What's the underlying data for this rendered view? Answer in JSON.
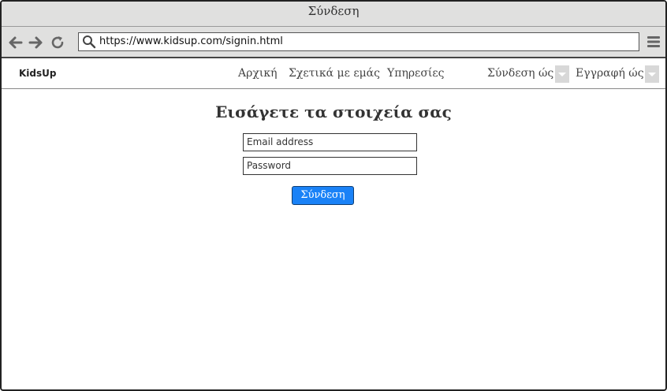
{
  "window": {
    "title": "Σύνδεση"
  },
  "toolbar": {
    "url": "https://www.kidsup.com/signin.html",
    "back_icon": "arrow-left-icon",
    "forward_icon": "arrow-right-icon",
    "reload_icon": "reload-icon",
    "search_icon": "search-icon",
    "menu_icon": "hamburger-menu-icon"
  },
  "navbar": {
    "brand": "KidsUp",
    "links": [
      "Αρχική",
      "Σχετικά με εμάς",
      "Υπηρεσίες"
    ],
    "login_as": "Σύνδεση ώς",
    "register_as": "Εγγραφή ώς"
  },
  "form": {
    "heading": "Εισάγετε τα στοιχεία σας",
    "email_placeholder": "Email address",
    "password_placeholder": "Password",
    "submit_label": "Σύνδεση"
  },
  "colors": {
    "button": "#1a82f7",
    "chrome": "#e0e0df"
  }
}
